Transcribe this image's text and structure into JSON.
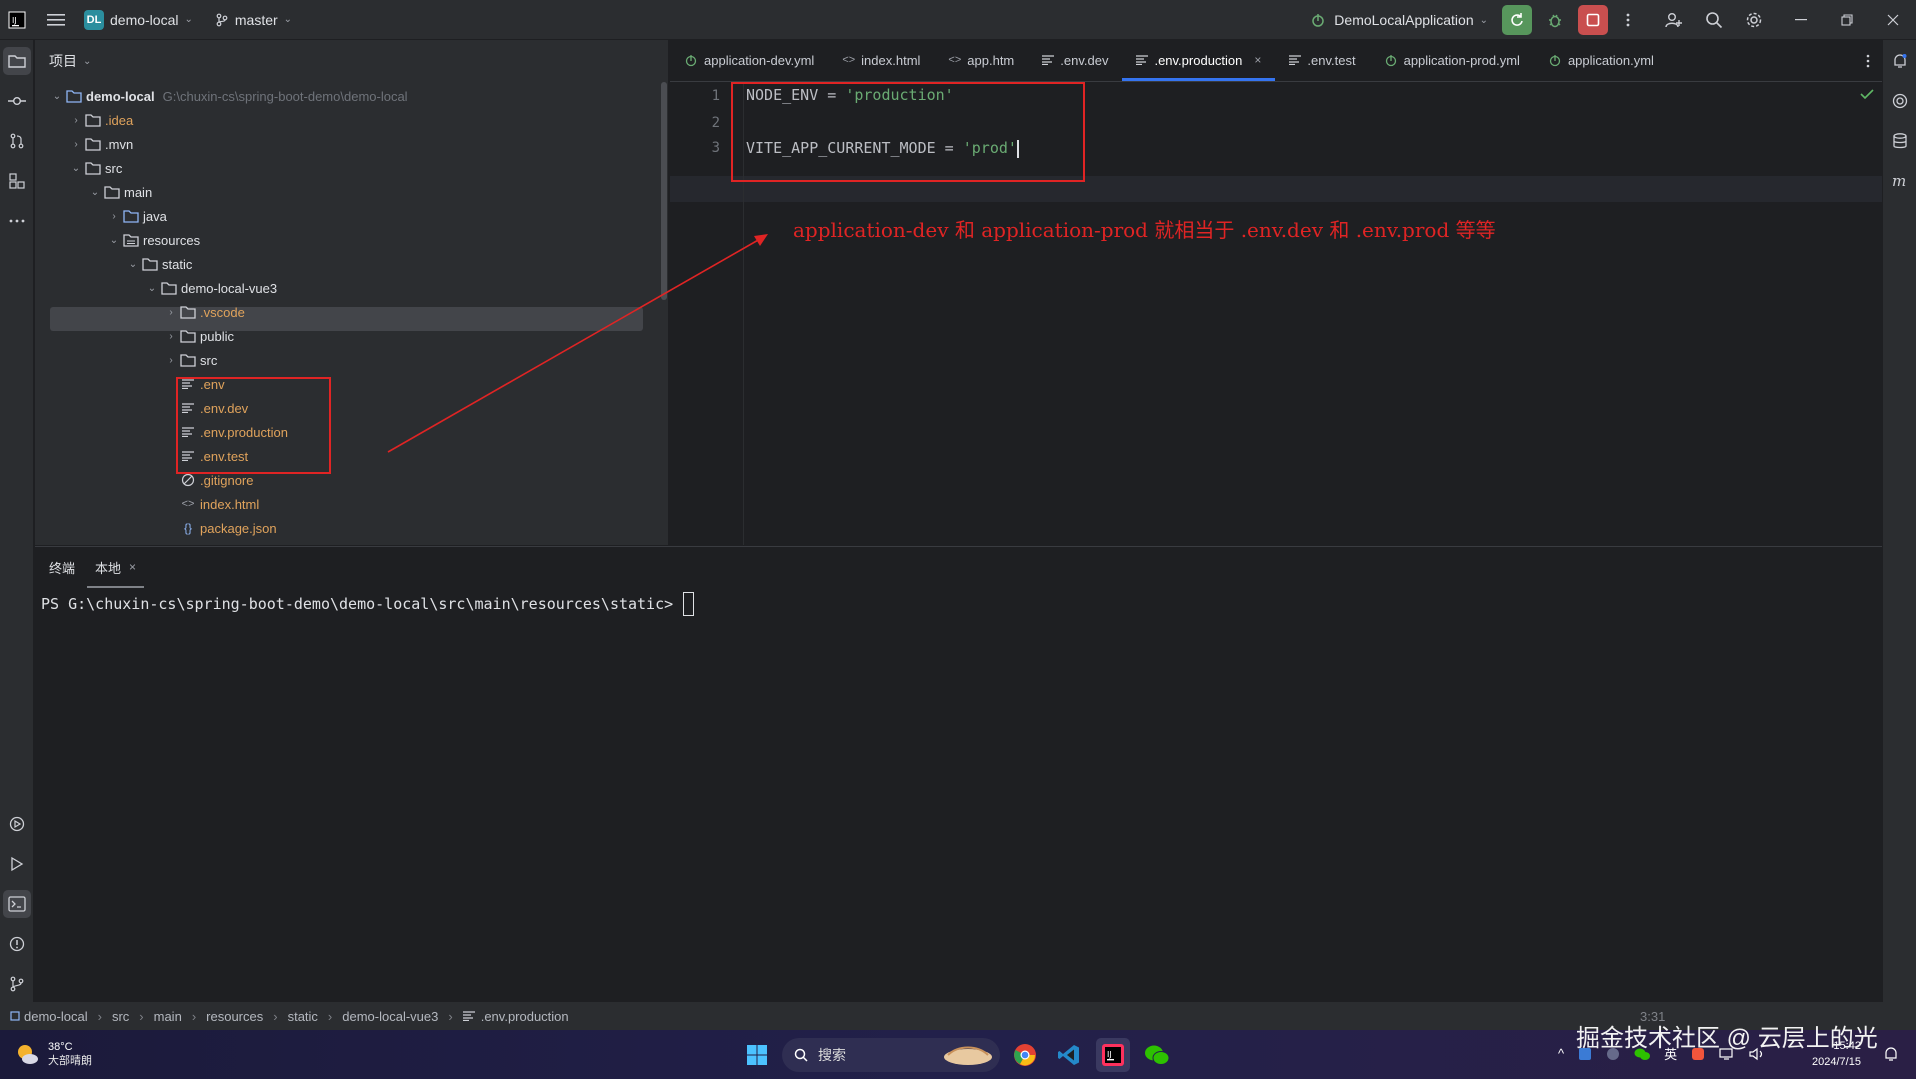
{
  "titlebar": {
    "project_badge": "DL",
    "project_name": "demo-local",
    "branch": "master",
    "run_config": "DemoLocalApplication"
  },
  "project_panel": {
    "header": "项目",
    "root_name": "demo-local",
    "root_path": "G:\\chuxin-cs\\spring-boot-demo\\demo-local",
    "tree": [
      {
        "label": ".idea"
      },
      {
        "label": ".mvn"
      },
      {
        "label": "src"
      },
      {
        "label": "main"
      },
      {
        "label": "java"
      },
      {
        "label": "resources"
      },
      {
        "label": "static"
      },
      {
        "label": "demo-local-vue3"
      },
      {
        "label": ".vscode"
      },
      {
        "label": "public"
      },
      {
        "label": "src"
      },
      {
        "label": ".env"
      },
      {
        "label": ".env.dev"
      },
      {
        "label": ".env.production"
      },
      {
        "label": ".env.test"
      },
      {
        "label": ".gitignore"
      },
      {
        "label": "index.html"
      },
      {
        "label": "package.json"
      }
    ]
  },
  "editor": {
    "tabs": [
      {
        "label": "application-dev.yml"
      },
      {
        "label": "index.html"
      },
      {
        "label": "app.htm"
      },
      {
        "label": ".env.dev"
      },
      {
        "label": ".env.production"
      },
      {
        "label": ".env.test"
      },
      {
        "label": "application-prod.yml"
      },
      {
        "label": "application.yml"
      }
    ],
    "line_numbers": [
      "1",
      "2",
      "3"
    ],
    "lines": [
      {
        "key": "NODE_ENV = ",
        "value": "'production'"
      },
      {
        "key": "",
        "value": ""
      },
      {
        "key": "VITE_APP_CURRENT_MODE = ",
        "value": "'prod'"
      }
    ],
    "annotation": "application-dev 和 application-prod 就相当于 .env.dev 和  .env.prod 等等"
  },
  "terminal": {
    "title": "终端",
    "tab": "本地",
    "prompt": "PS G:\\chuxin-cs\\spring-boot-demo\\demo-local\\src\\main\\resources\\static>"
  },
  "statusbar": {
    "breadcrumbs": [
      "demo-local",
      "src",
      "main",
      "resources",
      "static",
      "demo-local-vue3",
      ".env.production"
    ],
    "position": "3:31"
  },
  "taskbar": {
    "weather_temp": "38°C",
    "weather_desc": "大部晴朗",
    "search": "搜索",
    "time": "15:42",
    "date": "2024/7/15",
    "ime": "英",
    "watermark": "掘金技术社区 @ 云层上的光"
  }
}
